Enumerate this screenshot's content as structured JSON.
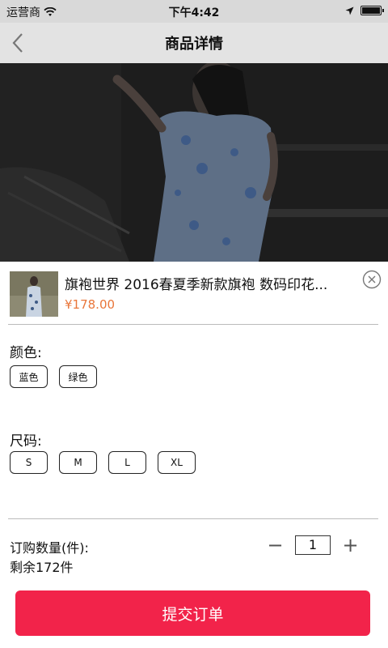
{
  "status_bar": {
    "carrier": "运营商",
    "time": "下午4:42"
  },
  "nav": {
    "title": "商品详情"
  },
  "product": {
    "name": "旗袍世界 2016春夏季新款旗袍 数码印花...",
    "price": "¥178.00"
  },
  "color_section": {
    "label": "颜色:",
    "options": [
      "蓝色",
      "绿色"
    ]
  },
  "size_section": {
    "label": "尺码:",
    "options": [
      "S",
      "M",
      "L",
      "XL"
    ]
  },
  "quantity": {
    "label": "订购数量(件):",
    "stock": "剩余172件",
    "value": "1",
    "minus": "−",
    "plus": "+"
  },
  "submit": {
    "label": "提交订单"
  },
  "colors": {
    "accent": "#f2234a",
    "price": "#e9763a",
    "nav_bg": "#e3e3e3"
  }
}
